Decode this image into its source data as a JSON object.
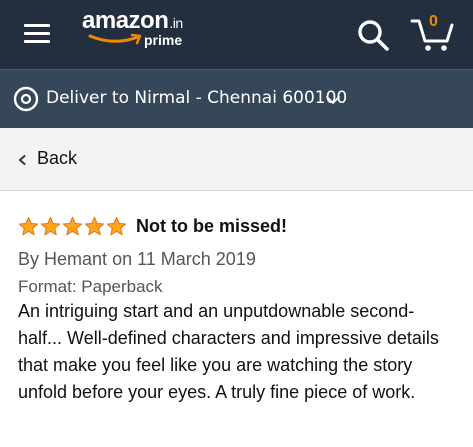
{
  "header": {
    "logo_text": "amazon",
    "logo_tld": ".in",
    "logo_sub": "prime",
    "cart_count": "0",
    "icons": [
      "hamburger-menu-icon",
      "search-icon",
      "cart-icon"
    ]
  },
  "delivery": {
    "text": "Deliver to Nirmal - Chennai 600100",
    "icons": [
      "location-pin-icon",
      "chevron-down-icon"
    ]
  },
  "nav": {
    "back_label": "Back"
  },
  "review": {
    "rating": 5,
    "rating_max": 5,
    "title": "Not to be missed!",
    "by_label": "By",
    "author": "Hemant",
    "date": "on 11 March 2019",
    "format": "Format: Paperback",
    "body": "An intriguing start and an unputdownable second-half... Well-defined characters and impressive details that make you feel like you are watching the story unfold before your eyes. A truly fine piece of work."
  },
  "colors": {
    "header_bg": "#232f3e",
    "delivery_bg": "#37475a",
    "star": "#ffa41c",
    "cart_count": "#f08804",
    "smile": "#f08804"
  }
}
